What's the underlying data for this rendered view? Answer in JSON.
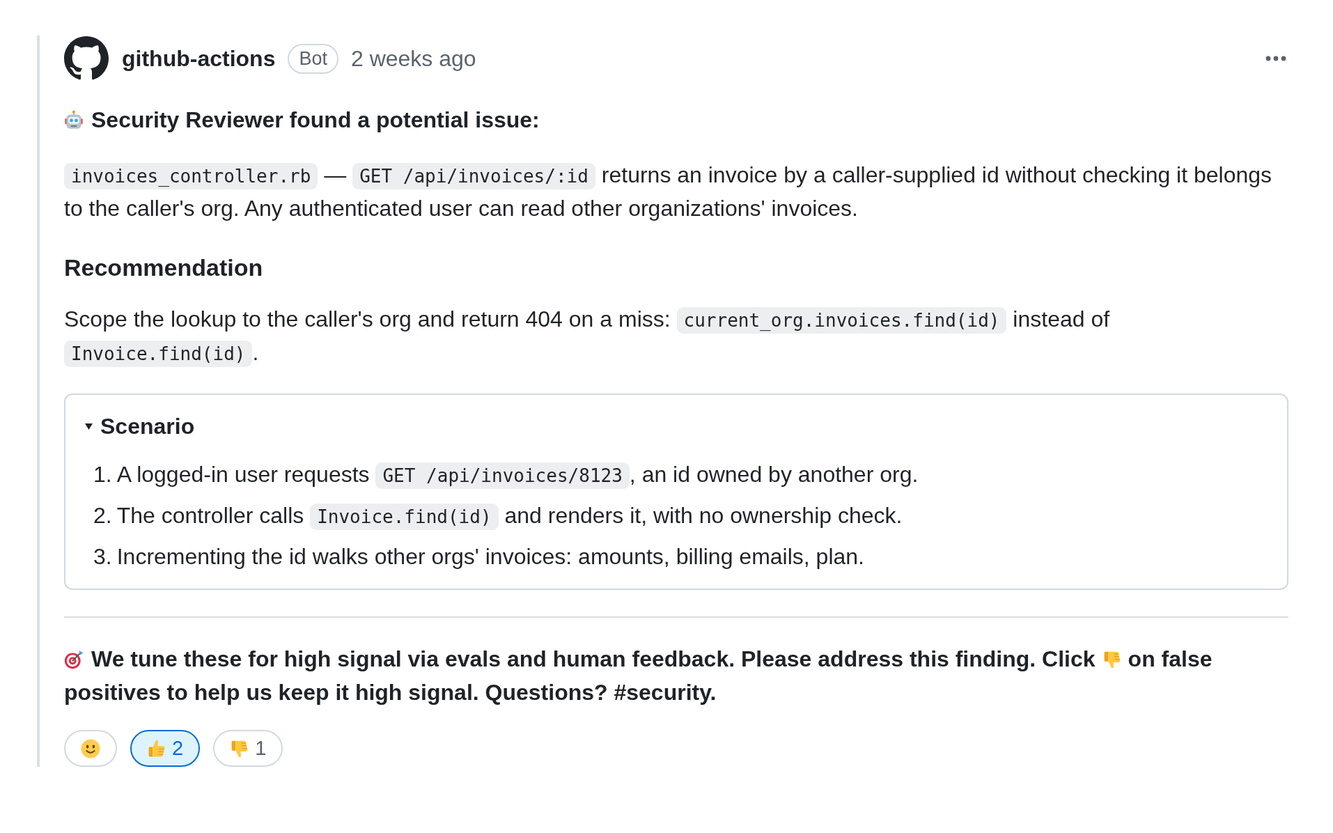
{
  "comment": {
    "author": "github-actions",
    "badge": "Bot",
    "time": "2 weeks ago",
    "title": "Security Reviewer found a potential issue:",
    "summary": [
      {
        "kind": "code",
        "text": "invoices_controller.rb"
      },
      {
        "kind": "text",
        "text": " — "
      },
      {
        "kind": "code",
        "text": "GET /api/invoices/:id"
      },
      {
        "kind": "text",
        "text": " returns an invoice by a caller-supplied id without checking it belongs to the caller's org. Any authenticated user can read other organizations' invoices."
      }
    ],
    "recommendation": {
      "heading": "Recommendation",
      "body": [
        {
          "kind": "text",
          "text": "Scope the lookup to the caller's org and return 404 on a miss: "
        },
        {
          "kind": "code",
          "text": "current_org.invoices.find(id)"
        },
        {
          "kind": "text",
          "text": " instead of "
        },
        {
          "kind": "code",
          "text": "Invoice.find(id)"
        },
        {
          "kind": "text",
          "text": "."
        }
      ]
    },
    "scenario": {
      "summary": "Scenario",
      "expanded": true,
      "steps": [
        {
          "number": "1.",
          "parts": [
            {
              "kind": "text",
              "text": "A logged-in user requests "
            },
            {
              "kind": "code",
              "text": "GET /api/invoices/8123"
            },
            {
              "kind": "text",
              "text": ", an id owned by another org."
            }
          ]
        },
        {
          "number": "2.",
          "parts": [
            {
              "kind": "text",
              "text": "The controller calls "
            },
            {
              "kind": "code",
              "text": "Invoice.find(id)"
            },
            {
              "kind": "text",
              "text": " and renders it, with no ownership check."
            }
          ]
        },
        {
          "number": "3.",
          "parts": [
            {
              "kind": "text",
              "text": "Incrementing the id walks other orgs' invoices: amounts, billing emails, plan."
            }
          ]
        }
      ]
    },
    "feedback": {
      "before_icon": "We tune these for high signal via evals and human feedback. Please address this finding. Click",
      "after_icon": "on false positives to help us keep it high signal. Questions? #security."
    },
    "reactions": [
      {
        "kind": "smile",
        "selected": false
      },
      {
        "kind": "thumbs_up",
        "count": "2",
        "selected": true
      },
      {
        "kind": "thumbs_down",
        "count": "1",
        "selected": false
      }
    ]
  }
}
